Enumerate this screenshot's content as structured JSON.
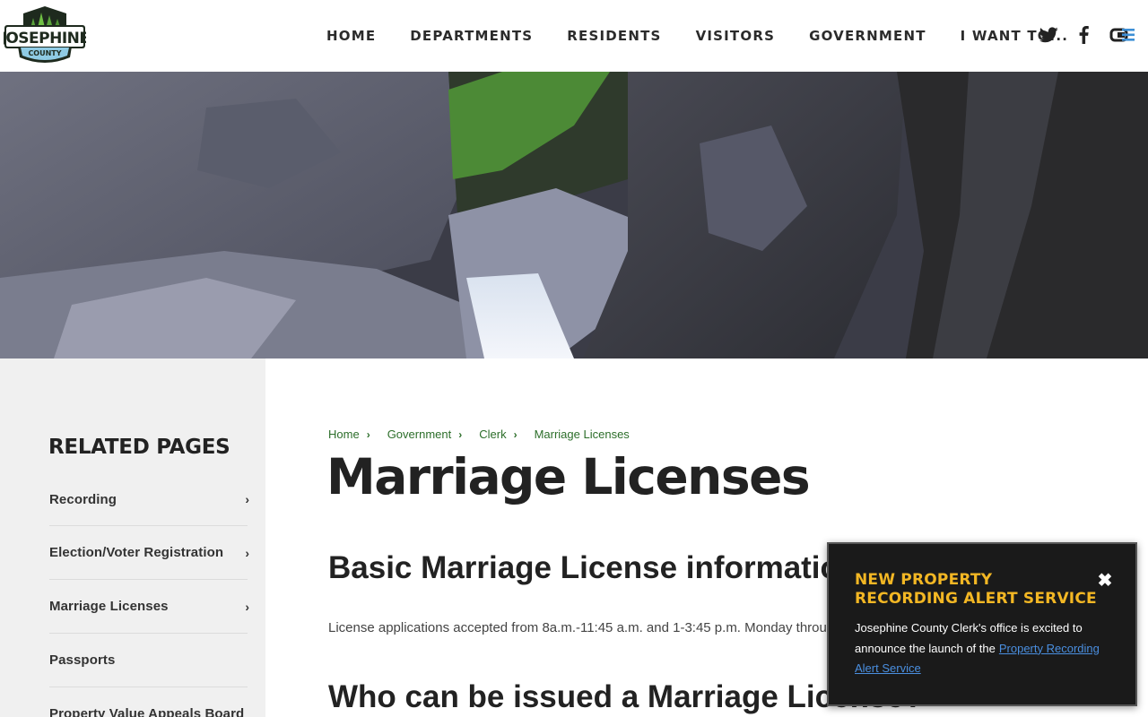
{
  "brand": {
    "name_top": "JOSEPHINE",
    "name_bottom": "COUNTY",
    "colors": {
      "green": "#5aa33b",
      "dark": "#1e2a1e",
      "sky": "#8fcbe4"
    }
  },
  "nav": {
    "items": [
      {
        "label": "HOME"
      },
      {
        "label": "DEPARTMENTS"
      },
      {
        "label": "RESIDENTS"
      },
      {
        "label": "VISITORS"
      },
      {
        "label": "GOVERNMENT"
      },
      {
        "label": "I WANT TO..."
      }
    ],
    "social": [
      "twitter-icon",
      "facebook-icon",
      "news-icon"
    ]
  },
  "sidebar": {
    "title": "RELATED PAGES",
    "items": [
      {
        "label": "Recording",
        "has_chevron": true
      },
      {
        "label": "Election/Voter Registration",
        "has_chevron": true
      },
      {
        "label": "Marriage Licenses",
        "has_chevron": true
      },
      {
        "label": "Passports",
        "has_chevron": false
      },
      {
        "label": "Property Value Appeals Board",
        "has_chevron": false
      }
    ],
    "chevron": "›"
  },
  "breadcrumb": {
    "items": [
      {
        "label": "Home"
      },
      {
        "label": "Government"
      },
      {
        "label": "Clerk"
      },
      {
        "label": "Marriage Licenses"
      }
    ],
    "separator": "›"
  },
  "main": {
    "title": "Marriage Licenses",
    "section1_heading": "Basic Marriage License information",
    "section1_text": "License applications accepted from 8a.m.-11:45 a.m. and 1-3:45 p.m. Monday through Fri",
    "section2_heading": "Who can be issued a Marriage License?"
  },
  "alert": {
    "title": "NEW PROPERTY RECORDING ALERT SERVICE",
    "close": "✖",
    "body": "Josephine County Clerk's office is excited to announce the launch of the",
    "link": "Property Recording Alert Service",
    "colors": {
      "title": "#f3b724",
      "link": "#4a8fe0"
    }
  }
}
